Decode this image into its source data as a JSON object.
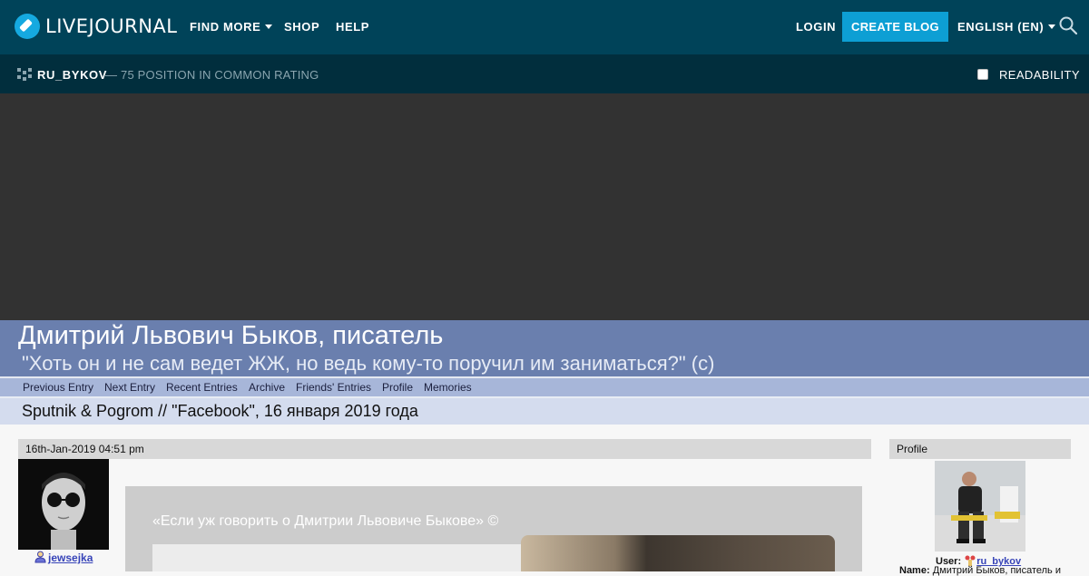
{
  "topnav": {
    "logo_text": "LIVEJOURNAL",
    "find_more": "FIND MORE",
    "shop": "SHOP",
    "help": "HELP",
    "login": "LOGIN",
    "create_blog": "CREATE BLOG",
    "language": "ENGLISH (EN)"
  },
  "subbar": {
    "journal_name": "RU_BYKOV",
    "rating": "— 75 POSITION IN COMMON RATING",
    "readability": "READABILITY"
  },
  "journal": {
    "title": "Дмитрий Львович Быков, писатель",
    "subtitle": "\"Хоть он и не сам ведет ЖЖ, но ведь кому-то поручил им заниматься?\" (с)",
    "nav": [
      "Previous Entry",
      "Next Entry",
      "Recent Entries",
      "Archive",
      "Friends' Entries",
      "Profile",
      "Memories"
    ],
    "entry_title": "Sputnik & Pogrom // \"Facebook\", 16 января 2019 года"
  },
  "entry": {
    "date": "16th-Jan-2019 04:51 pm",
    "poster": "jewsejka",
    "quote": "«Если уж говорить о Дмитрии Львовиче Быкове» ©"
  },
  "sidebar": {
    "heading": "Profile",
    "user_label": "User:",
    "user": "ru_bykov",
    "name_label": "Name:",
    "name_value": "Дмитрий Быков, писатель и"
  },
  "colors": {
    "topnav_bg": "#004359",
    "accent": "#0d9fd4",
    "header_band": "#6a7fae"
  }
}
